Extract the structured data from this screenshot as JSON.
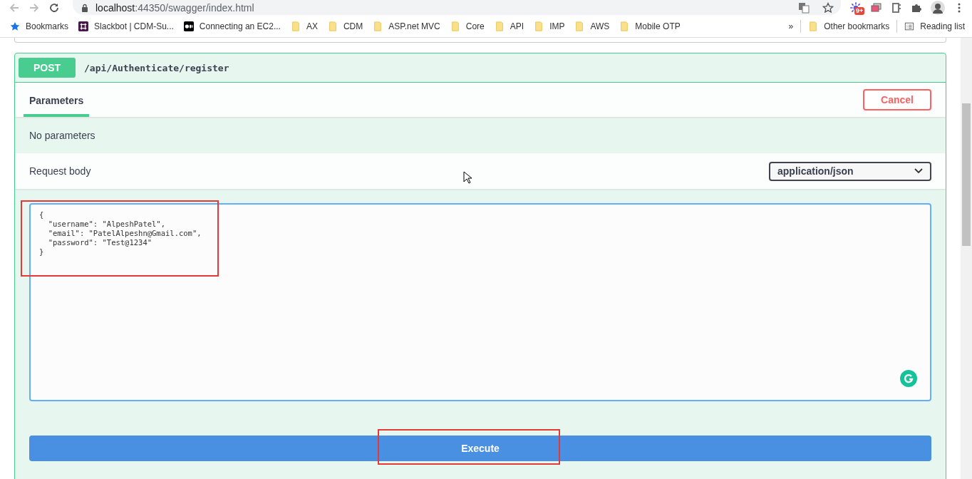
{
  "browser": {
    "url_host": "localhost",
    "url_path": ":44350/swagger/index.html",
    "extension_badge": "9+"
  },
  "bookmarks": [
    {
      "label": "Bookmarks",
      "kind": "star"
    },
    {
      "label": "Slackbot | CDM-Su...",
      "kind": "slack"
    },
    {
      "label": "Connecting an EC2...",
      "kind": "medium"
    },
    {
      "label": "AX",
      "kind": "folder"
    },
    {
      "label": "CDM",
      "kind": "folder"
    },
    {
      "label": "ASP.net MVC",
      "kind": "folder"
    },
    {
      "label": "Core",
      "kind": "folder"
    },
    {
      "label": "API",
      "kind": "folder"
    },
    {
      "label": "IMP",
      "kind": "folder"
    },
    {
      "label": "AWS",
      "kind": "folder"
    },
    {
      "label": "Mobile OTP",
      "kind": "folder"
    }
  ],
  "bookmarks_more": "»",
  "other_bookmarks": "Other bookmarks",
  "reading_list": "Reading list",
  "operation": {
    "method": "POST",
    "path": "/api/Authenticate/register"
  },
  "tabs": [
    {
      "label": "Parameters",
      "selected": true
    }
  ],
  "cancel_button": "Cancel",
  "no_parameters": "No parameters",
  "request_body": {
    "label": "Request body",
    "content_type": "application/json",
    "highlighted": true,
    "lines": [
      "{",
      "  \"username\": \"AlpeshPatel\",",
      "  \"email\": \"PatelAlpeshn@Gmail.com\",",
      "  \"password\": \"Test@1234\"",
      "}"
    ]
  },
  "execute_button": {
    "label": "Execute",
    "highlighted": true
  }
}
